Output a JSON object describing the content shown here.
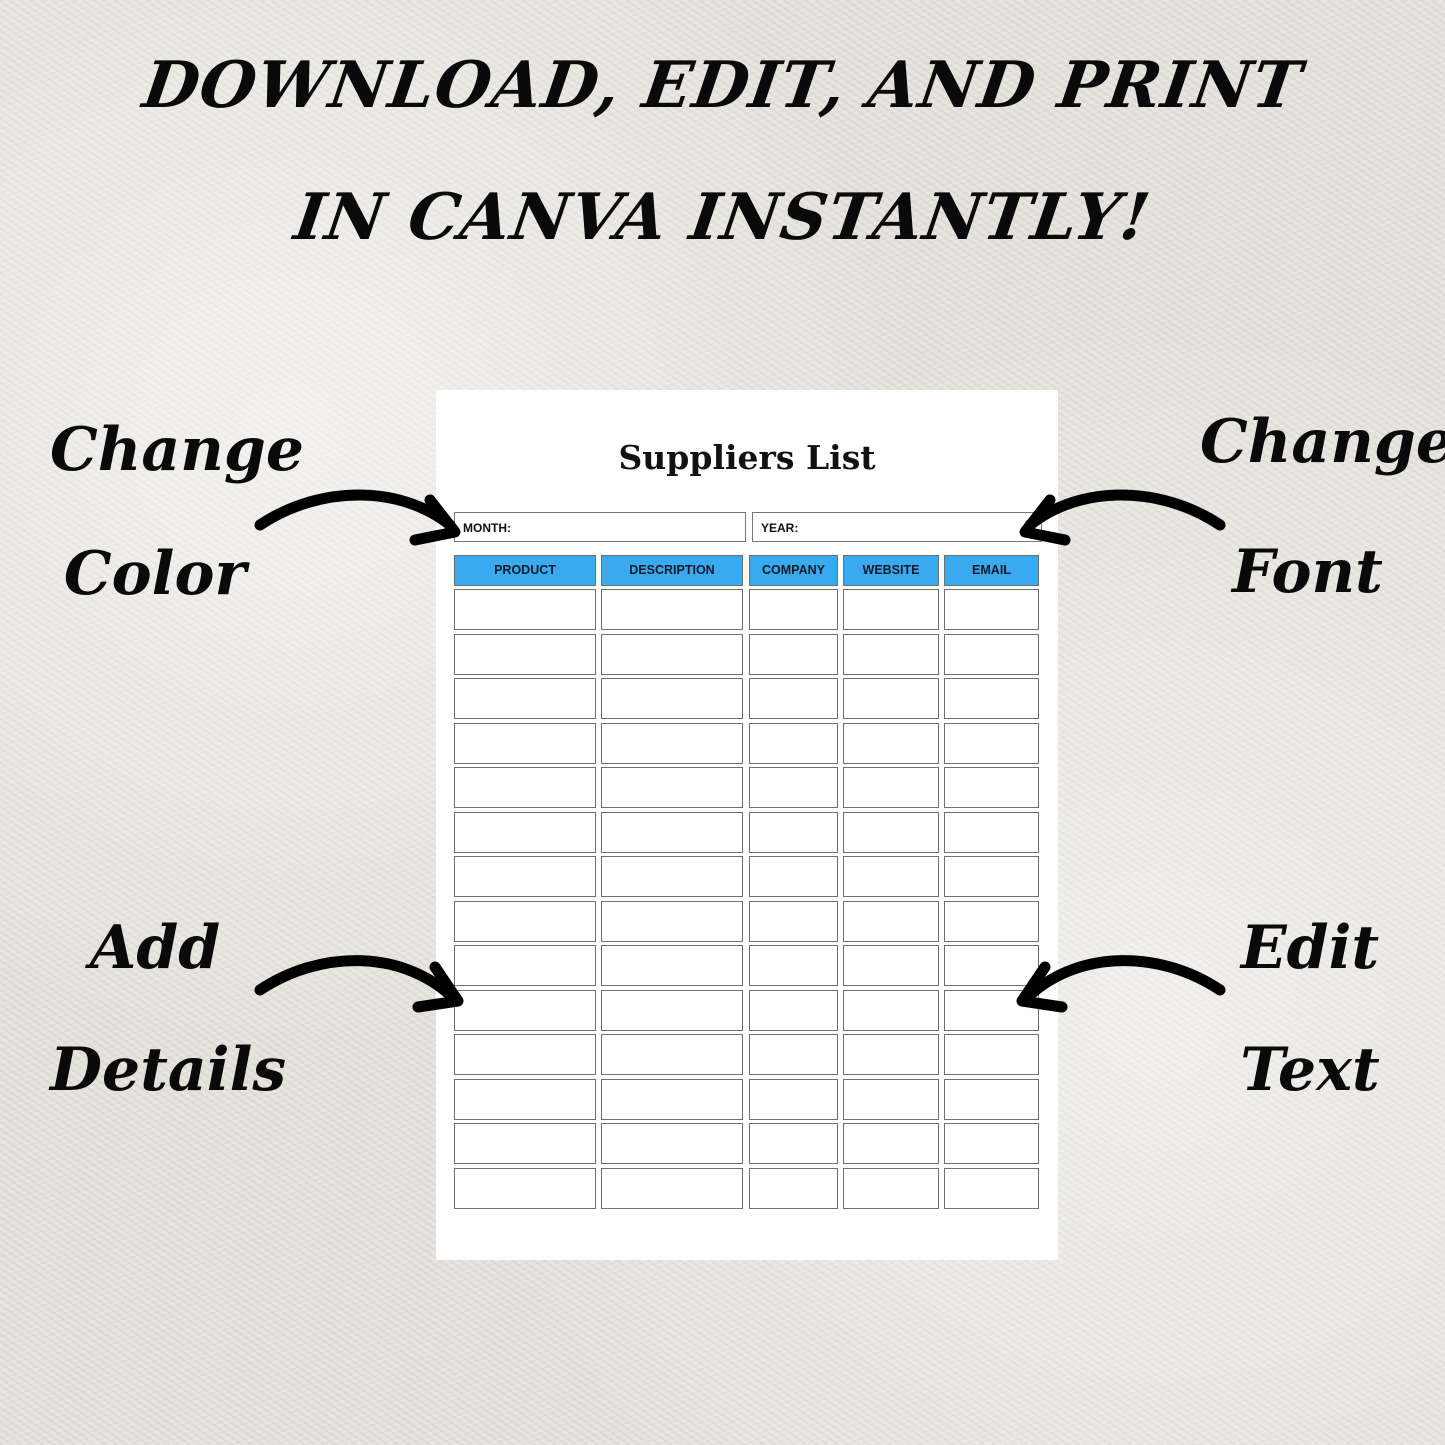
{
  "headline": {
    "line1": "DOWNLOAD, EDIT, AND PRINT",
    "line2": "IN CANVA INSTANTLY!"
  },
  "annotations": {
    "top_left": [
      "Change",
      "Color"
    ],
    "top_right": [
      "Change",
      "Font"
    ],
    "bottom_left": [
      "Add",
      "Details"
    ],
    "bottom_right": [
      "Edit",
      "Text"
    ]
  },
  "template": {
    "title": "Suppliers List",
    "month_label": "MONTH:",
    "year_label": "YEAR:",
    "header_color": "#3aaaf0",
    "columns": [
      "PRODUCT",
      "DESCRIPTION",
      "COMPANY",
      "WEBSITE",
      "EMAIL"
    ],
    "row_count": 14
  }
}
